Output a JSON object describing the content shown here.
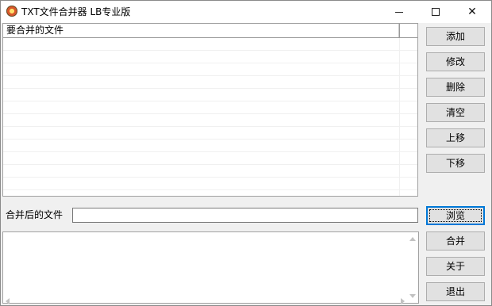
{
  "window": {
    "title": "TXT文件合并器 LB专业版",
    "minimize_glyph": "",
    "close_glyph": "✕"
  },
  "file_list": {
    "column_header": "要合并的文件",
    "items": []
  },
  "buttons": {
    "add": "添加",
    "modify": "修改",
    "delete": "删除",
    "clear": "清空",
    "move_up": "上移",
    "move_down": "下移",
    "browse": "浏览",
    "merge": "合并",
    "about": "关于",
    "exit": "退出"
  },
  "output": {
    "label": "合并后的文件",
    "value": ""
  },
  "log": {
    "text": ""
  },
  "colors": {
    "focus_accent": "#0078d7",
    "window_bg": "#f0f0f0"
  }
}
